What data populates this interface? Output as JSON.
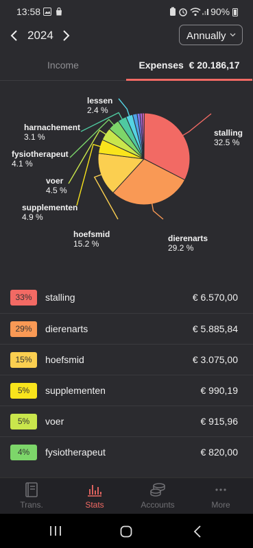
{
  "status_bar": {
    "time": "13:58",
    "battery": "90%"
  },
  "header": {
    "year": "2024",
    "period": "Annually"
  },
  "tabs": {
    "income": "Income",
    "expenses_label": "Expenses",
    "expenses_total": "€ 20.186,17"
  },
  "chart_data": {
    "type": "pie",
    "slices": [
      {
        "name": "stalling",
        "percent": 32.5,
        "color": "#f26a64"
      },
      {
        "name": "dierenarts",
        "percent": 29.2,
        "color": "#f99955"
      },
      {
        "name": "hoefsmid",
        "percent": 15.2,
        "color": "#fbcf50"
      },
      {
        "name": "supplementen",
        "percent": 4.9,
        "color": "#f9e41c"
      },
      {
        "name": "voer",
        "percent": 4.5,
        "color": "#c9e64c"
      },
      {
        "name": "fysiotherapeut",
        "percent": 4.1,
        "color": "#7dd66a"
      },
      {
        "name": "harnachement",
        "percent": 3.1,
        "color": "#4fc9a0"
      },
      {
        "name": "lessen",
        "percent": 2.4,
        "color": "#55d3e3"
      },
      {
        "name": "",
        "percent": 1.6,
        "color": "#4ea3e8"
      },
      {
        "name": "",
        "percent": 1.0,
        "color": "#7f7cf0"
      },
      {
        "name": "",
        "percent": 0.8,
        "color": "#b46be0"
      },
      {
        "name": "",
        "percent": 0.7,
        "color": "#e066b8"
      }
    ],
    "labels": [
      {
        "name": "stalling",
        "value": "32.5 %"
      },
      {
        "name": "dierenarts",
        "value": "29.2 %"
      },
      {
        "name": "hoefsmid",
        "value": "15.2 %"
      },
      {
        "name": "supplementen",
        "value": "4.9 %"
      },
      {
        "name": "voer",
        "value": "4.5 %"
      },
      {
        "name": "fysiotherapeut",
        "value": "4.1 %"
      },
      {
        "name": "harnachement",
        "value": "3.1 %"
      },
      {
        "name": "lessen",
        "value": "2.4 %"
      }
    ]
  },
  "list": [
    {
      "pct": "33%",
      "category": "stalling",
      "amount": "€ 6.570,00",
      "color": "#f26a64"
    },
    {
      "pct": "29%",
      "category": "dierenarts",
      "amount": "€ 5.885,84",
      "color": "#f99955"
    },
    {
      "pct": "15%",
      "category": "hoefsmid",
      "amount": "€ 3.075,00",
      "color": "#fbcf50"
    },
    {
      "pct": "5%",
      "category": "supplementen",
      "amount": "€ 990,19",
      "color": "#f9e41c"
    },
    {
      "pct": "5%",
      "category": "voer",
      "amount": "€ 915,96",
      "color": "#c9e64c"
    },
    {
      "pct": "4%",
      "category": "fysiotherapeut",
      "amount": "€ 820,00",
      "color": "#7dd66a"
    }
  ],
  "nav": {
    "trans": "Trans.",
    "stats": "Stats",
    "accounts": "Accounts",
    "more": "More"
  }
}
